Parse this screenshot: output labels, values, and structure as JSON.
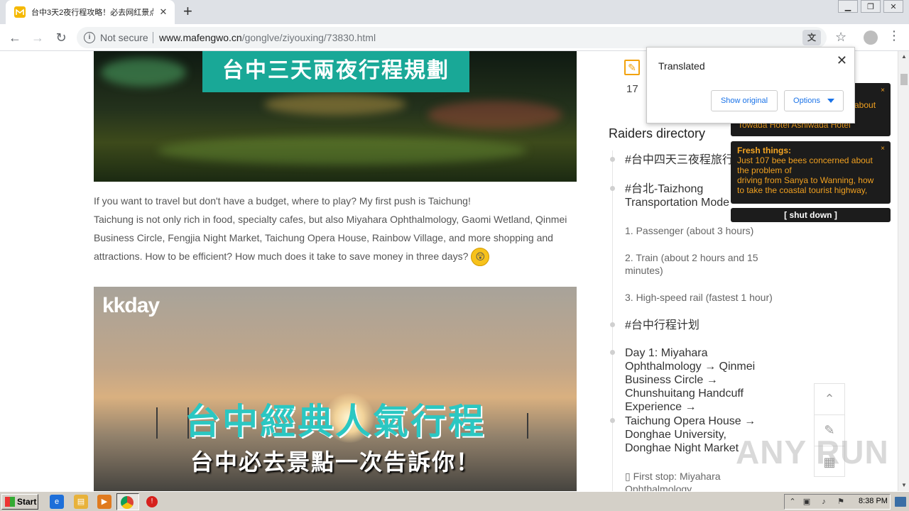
{
  "browser": {
    "tab_title": "台中3天2夜行程攻略！必去网红景点",
    "tab_close": "✕",
    "new_tab": "+",
    "security_label": "Not secure",
    "url_host": "www.mafengwo.cn",
    "url_path": "/gonglve/ziyouxing/73830.html"
  },
  "translate_popup": {
    "title": "Translated",
    "show_original": "Show original",
    "options": "Options"
  },
  "article": {
    "banner1_caption": "台中三天兩夜行程規劃",
    "paragraph_line1": "If you want to travel but don't have a budget, where to play? My first push is Taichung!",
    "paragraph_line2": "Taichung is not only rich in food, specialty cafes, but also Miyahara Ophthalmology, Gaomi Wetland, Qinmei Business Circle, Fengjia Night Market, Taichung Opera House, Rainbow Village, and more shopping and attractions. How to be efficient? How much does it take to save money in three days?",
    "banner2_logo": "kkday",
    "banner2_title": "台中經典人氣行程",
    "banner2_subtitle": "台中必去景點一次告訴你！"
  },
  "sidebar": {
    "count": "17",
    "directory_title": "Raiders directory",
    "items": [
      {
        "text": "#台中四天三夜程旅行",
        "kind": "h"
      },
      {
        "text": "#台北-Taizhong Transportation Mode",
        "kind": "h"
      },
      {
        "text": "1. Passenger (about 3 hours)",
        "kind": "sub"
      },
      {
        "text": "2. Train (about 2 hours and 15 minutes)",
        "kind": "sub"
      },
      {
        "text": "3. High-speed rail (fastest 1 hour)",
        "kind": "sub"
      },
      {
        "text": "#台中行程计划",
        "kind": "h"
      },
      {
        "text": "Day 1: Miyahara Ophthalmology → Qinmei Business Circle → Chunshuitang Handcuff Experience →",
        "kind": "h"
      },
      {
        "text": "Taichung Opera House → Donghae University, Donghae Night Market",
        "kind": "h"
      },
      {
        "text": "▯ First stop: Miyahara Ophthalmology",
        "kind": "sub"
      }
    ]
  },
  "notifications": {
    "first_partial": "about",
    "first_line2": "Towada Hotel Ashiwada Hotel",
    "second_label": "Fresh things:",
    "second_text1": "Just 107 bee bees concerned about the problem of",
    "second_text2": "driving from Sanya to Wanning, how to take the coastal tourist highway,",
    "close": "×",
    "shutdown": "[ shut down ]"
  },
  "watermark": "ANY RUN",
  "taskbar": {
    "start_label": "Start",
    "clock": "8:38 PM"
  }
}
